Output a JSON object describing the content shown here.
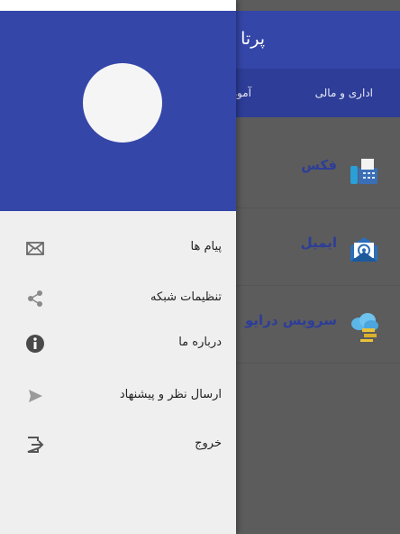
{
  "app": {
    "title": "پرتا",
    "tabs": [
      {
        "label": "اداری و مالی"
      },
      {
        "label": "آموز"
      }
    ],
    "services": [
      {
        "label": "فکس",
        "icon": "fax-machine-icon"
      },
      {
        "label": "ایمیل",
        "icon": "email-at-icon"
      },
      {
        "label": "سرویس درایو",
        "icon": "cloud-drive-icon"
      }
    ]
  },
  "drawer": {
    "header_color": "#3446a8",
    "items": [
      {
        "label": "پیام ها",
        "icon": "envelope-icon"
      },
      {
        "label": "تنظیمات شبکه",
        "icon": "share-icon"
      },
      {
        "label": "درباره ما",
        "icon": "info-icon"
      },
      {
        "label": "ارسال نظر و پیشنهاد",
        "icon": "send-icon"
      },
      {
        "label": "خروج",
        "icon": "exit-icon"
      }
    ]
  },
  "colors": {
    "primary": "#3446a8",
    "primary_dark": "#2d3d98",
    "scrim": "#5c5c5c",
    "drawer_bg": "#efefef"
  }
}
